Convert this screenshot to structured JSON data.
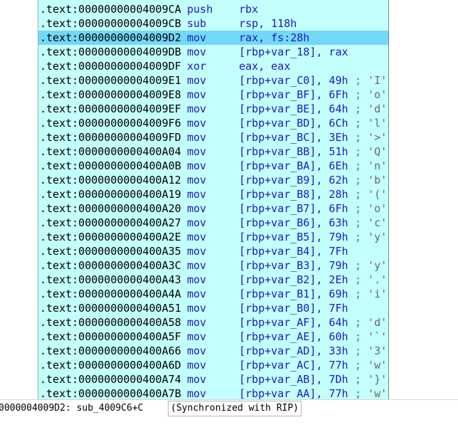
{
  "disassembly": {
    "lines": [
      {
        "addr": ".text:00000000004009CA",
        "mnemonic": "push",
        "operands": "rbx",
        "comment": ""
      },
      {
        "addr": ".text:00000000004009CB",
        "mnemonic": "sub",
        "operands": "rsp, 118h",
        "comment": ""
      },
      {
        "addr": ".text:00000000004009D2",
        "mnemonic": "mov",
        "operands": "rax, fs:28h",
        "comment": "",
        "selected": true
      },
      {
        "addr": ".text:00000000004009DB",
        "mnemonic": "mov",
        "operands": "[rbp+var_18], rax",
        "comment": ""
      },
      {
        "addr": ".text:00000000004009DF",
        "mnemonic": "xor",
        "operands": "eax, eax",
        "comment": ""
      },
      {
        "addr": ".text:00000000004009E1",
        "mnemonic": "mov",
        "operands": "[rbp+var_C0], 49h",
        "comment": "; 'I'"
      },
      {
        "addr": ".text:00000000004009E8",
        "mnemonic": "mov",
        "operands": "[rbp+var_BF], 6Fh",
        "comment": "; 'o'"
      },
      {
        "addr": ".text:00000000004009EF",
        "mnemonic": "mov",
        "operands": "[rbp+var_BE], 64h",
        "comment": "; 'd'"
      },
      {
        "addr": ".text:00000000004009F6",
        "mnemonic": "mov",
        "operands": "[rbp+var_BD], 6Ch",
        "comment": "; 'l'"
      },
      {
        "addr": ".text:00000000004009FD",
        "mnemonic": "mov",
        "operands": "[rbp+var_BC], 3Eh",
        "comment": "; '>'"
      },
      {
        "addr": ".text:0000000000400A04",
        "mnemonic": "mov",
        "operands": "[rbp+var_BB], 51h",
        "comment": "; 'Q'"
      },
      {
        "addr": ".text:0000000000400A0B",
        "mnemonic": "mov",
        "operands": "[rbp+var_BA], 6Eh",
        "comment": "; 'n'"
      },
      {
        "addr": ".text:0000000000400A12",
        "mnemonic": "mov",
        "operands": "[rbp+var_B9], 62h",
        "comment": "; 'b'"
      },
      {
        "addr": ".text:0000000000400A19",
        "mnemonic": "mov",
        "operands": "[rbp+var_B8], 28h",
        "comment": "; '('"
      },
      {
        "addr": ".text:0000000000400A20",
        "mnemonic": "mov",
        "operands": "[rbp+var_B7], 6Fh",
        "comment": "; 'o'"
      },
      {
        "addr": ".text:0000000000400A27",
        "mnemonic": "mov",
        "operands": "[rbp+var_B6], 63h",
        "comment": "; 'c'"
      },
      {
        "addr": ".text:0000000000400A2E",
        "mnemonic": "mov",
        "operands": "[rbp+var_B5], 79h",
        "comment": "; 'y'"
      },
      {
        "addr": ".text:0000000000400A35",
        "mnemonic": "mov",
        "operands": "[rbp+var_B4], 7Fh",
        "comment": ""
      },
      {
        "addr": ".text:0000000000400A3C",
        "mnemonic": "mov",
        "operands": "[rbp+var_B3], 79h",
        "comment": "; 'y'"
      },
      {
        "addr": ".text:0000000000400A43",
        "mnemonic": "mov",
        "operands": "[rbp+var_B2], 2Eh",
        "comment": "; '.'"
      },
      {
        "addr": ".text:0000000000400A4A",
        "mnemonic": "mov",
        "operands": "[rbp+var_B1], 69h",
        "comment": "; 'i'"
      },
      {
        "addr": ".text:0000000000400A51",
        "mnemonic": "mov",
        "operands": "[rbp+var_B0], 7Fh",
        "comment": ""
      },
      {
        "addr": ".text:0000000000400A58",
        "mnemonic": "mov",
        "operands": "[rbp+var_AF], 64h",
        "comment": "; 'd'"
      },
      {
        "addr": ".text:0000000000400A5F",
        "mnemonic": "mov",
        "operands": "[rbp+var_AE], 60h",
        "comment": "; '`'"
      },
      {
        "addr": ".text:0000000000400A66",
        "mnemonic": "mov",
        "operands": "[rbp+var_AD], 33h",
        "comment": "; '3'"
      },
      {
        "addr": ".text:0000000000400A6D",
        "mnemonic": "mov",
        "operands": "[rbp+var_AC], 77h",
        "comment": "; 'w'"
      },
      {
        "addr": ".text:0000000000400A74",
        "mnemonic": "mov",
        "operands": "[rbp+var_AB], 7Dh",
        "comment": "; '}'"
      },
      {
        "addr": ".text:0000000000400A7B",
        "mnemonic": "mov",
        "operands": "[rbp+var_AA], 77h",
        "comment": "; 'w'"
      }
    ]
  },
  "status": {
    "location": "0000004009D2: sub_4009C6+C",
    "sync": "(Synchronized with RIP)"
  },
  "colors": {
    "background": "#c3fffb",
    "selection": "#73d8f8",
    "instruction": "#1a1ac0",
    "comment": "#6a6a6a"
  }
}
